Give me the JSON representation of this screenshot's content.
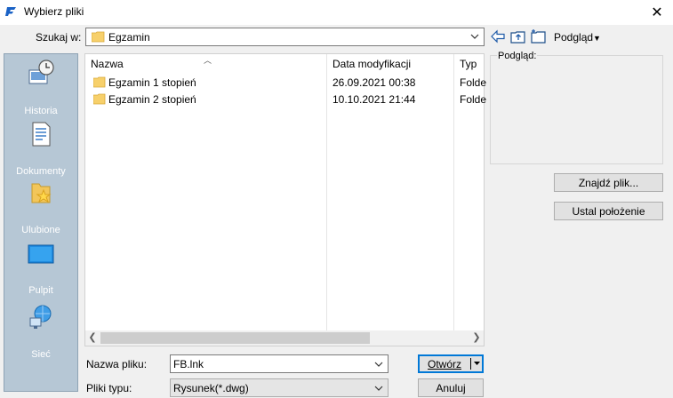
{
  "window": {
    "title": "Wybierz pliki",
    "close_glyph": "✕",
    "accent": "#0078d7"
  },
  "toolbar": {
    "lookin_label": "Szukaj w:",
    "lookin_value": "Egzamin",
    "icons": [
      "back-arrow-icon",
      "up-folder-icon",
      "new-folder-icon"
    ],
    "preview_menu_label": "Podgląd"
  },
  "places": [
    {
      "label": "Historia",
      "icon": "history-icon"
    },
    {
      "label": "Dokumenty",
      "icon": "documents-icon"
    },
    {
      "label": "Ulubione",
      "icon": "favorites-icon"
    },
    {
      "label": "Pulpit",
      "icon": "desktop-icon"
    },
    {
      "label": "Sieć",
      "icon": "network-icon"
    }
  ],
  "filelist": {
    "columns": [
      "Nazwa",
      "Data modyfikacji",
      "Typ"
    ],
    "rows": [
      {
        "name": "Egzamin 1 stopień",
        "date": "26.09.2021 00:38",
        "type": "Folde"
      },
      {
        "name": "Egzamin 2 stopień",
        "date": "10.10.2021 21:44",
        "type": "Folde"
      }
    ]
  },
  "preview": {
    "label": "Podgląd:"
  },
  "buttons": {
    "find_file": "Znajdź plik...",
    "set_location": "Ustal położenie",
    "open": "Otwórz",
    "cancel": "Anuluj"
  },
  "bottom": {
    "filename_label": "Nazwa pliku:",
    "filename_value": "FB.lnk",
    "filetype_label": "Pliki typu:",
    "filetype_value": "Rysunek(*.dwg)"
  }
}
